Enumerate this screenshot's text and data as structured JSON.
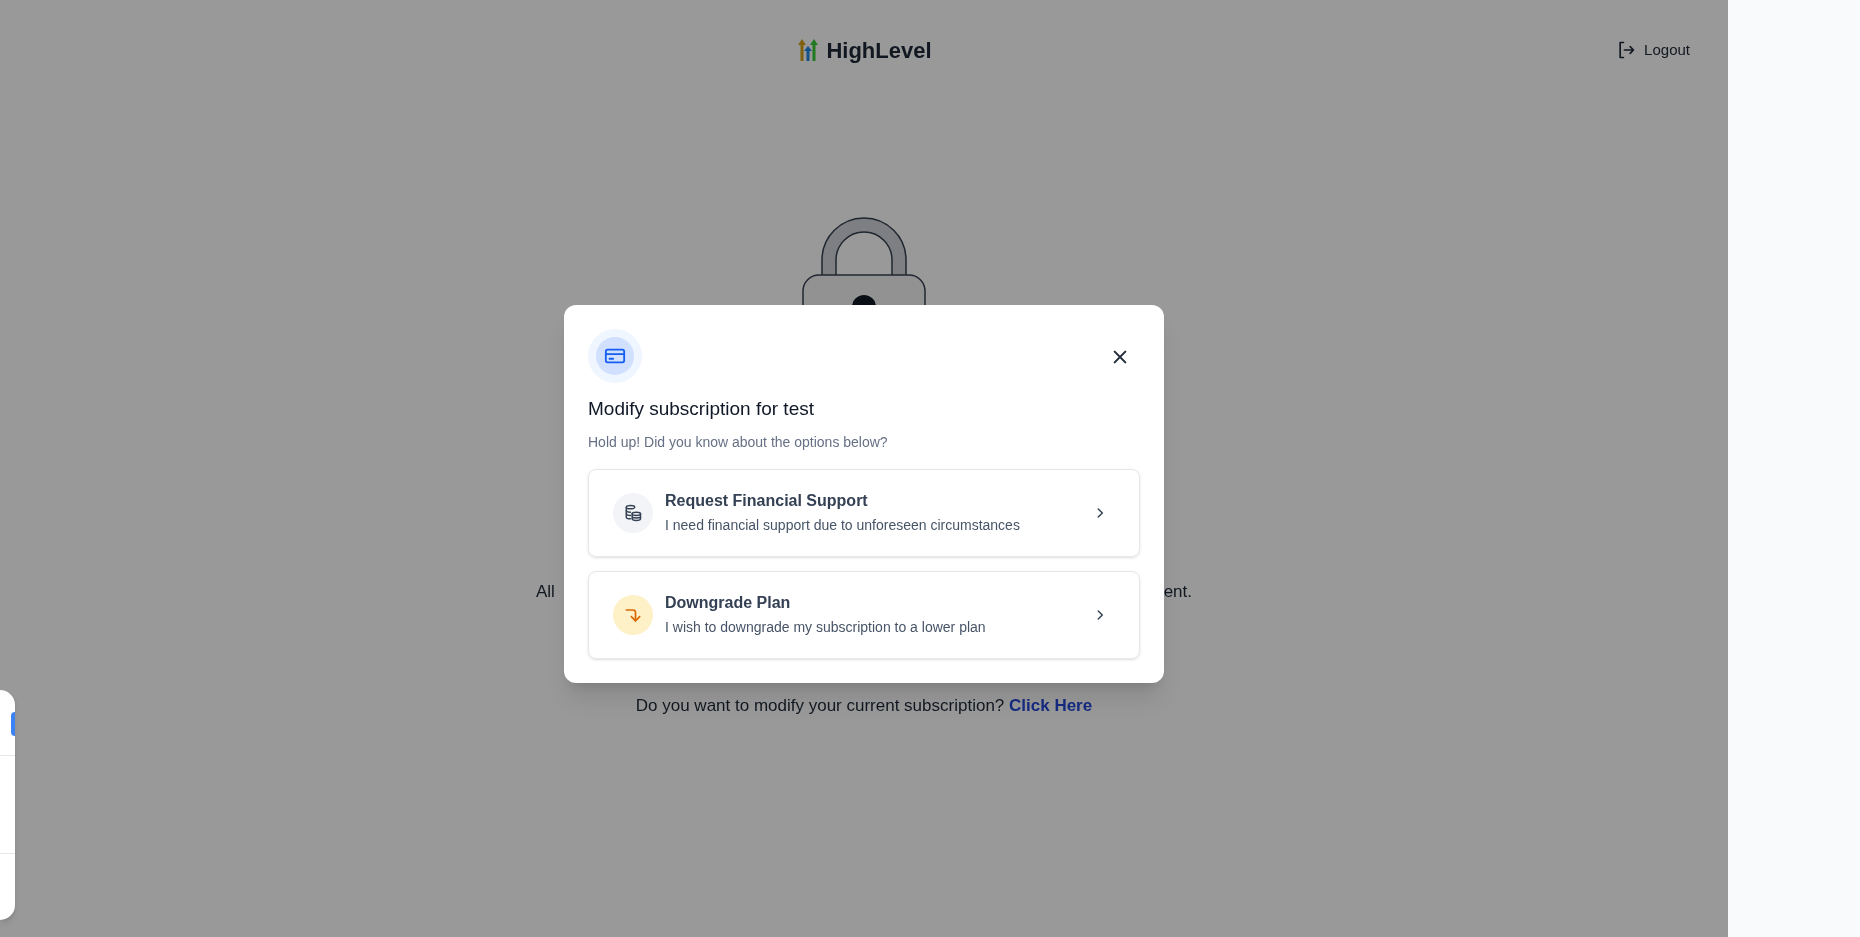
{
  "header": {
    "logo_text": "HighLevel",
    "logout_label": "Logout"
  },
  "page": {
    "paragraph_start": "All",
    "paragraph_end": "ent.",
    "prompt": "Do you want to modify your current subscription?",
    "link": "Click Here"
  },
  "modal": {
    "title": "Modify subscription for test",
    "subtitle": "Hold up! Did you know about the options below?",
    "options": [
      {
        "kind": "financial",
        "title": "Request Financial Support",
        "description": "I need financial support due to unforeseen circumstances"
      },
      {
        "kind": "downgrade",
        "title": "Downgrade Plan",
        "description": "I wish to downgrade my subscription to a lower plan"
      }
    ]
  }
}
